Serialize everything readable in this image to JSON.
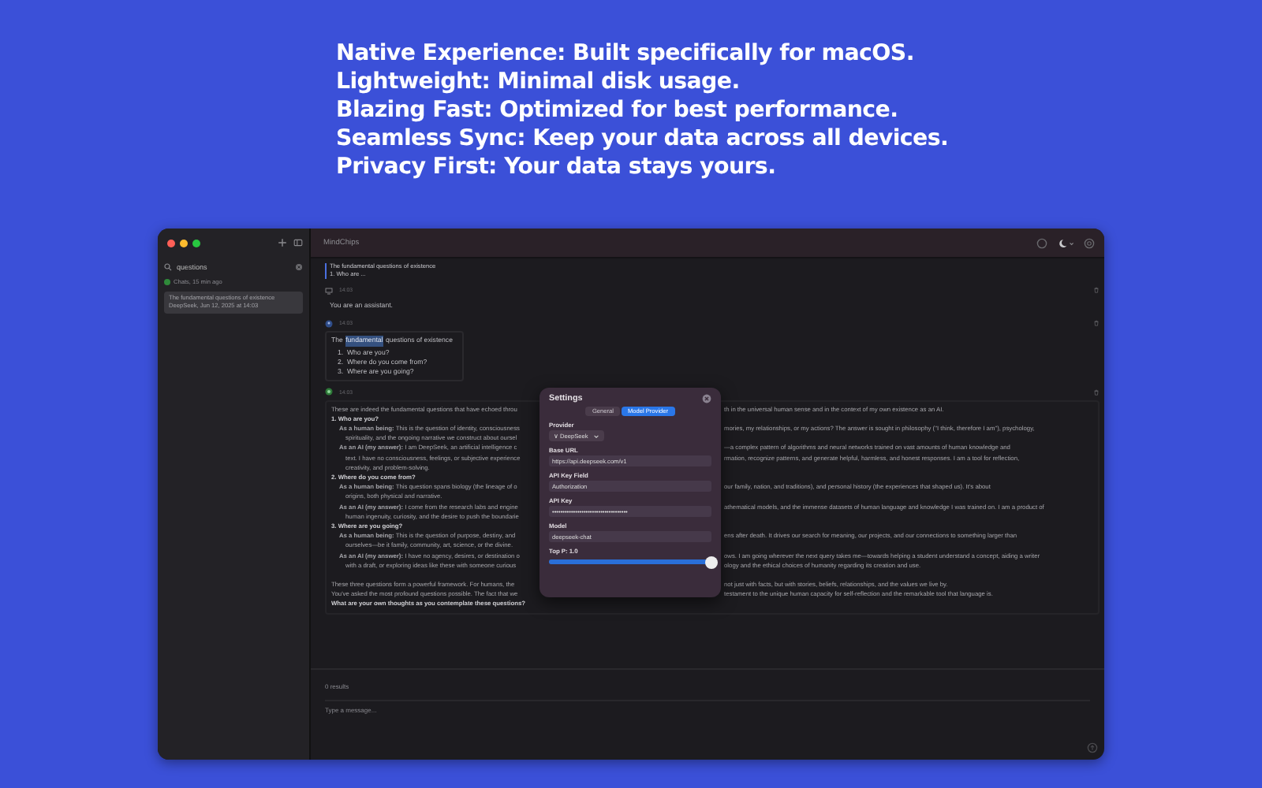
{
  "headlines": [
    "Native Experience: Built specifically for macOS.",
    "Lightweight: Minimal disk usage.",
    "Blazing Fast: Optimized for best performance.",
    "Seamless Sync: Keep your data across all devices.",
    "Privacy First: Your data stays yours."
  ],
  "window": {
    "title": "MindChips"
  },
  "sidebar": {
    "search": {
      "value": "questions"
    },
    "status": "Chats, 15 min ago",
    "items": [
      {
        "title": "The fundamental questions of existence",
        "subtitle": "DeepSeek, Jun 12, 2025 at 14:03",
        "selected": true
      }
    ]
  },
  "quote": {
    "title": "The fundamental questions of existence",
    "preview": "1. Who are ..."
  },
  "messages": [
    {
      "kind": "system",
      "time": "14:03",
      "text": "You are an assistant."
    },
    {
      "kind": "user",
      "time": "14:03",
      "text_before": "The",
      "highlight": "fundamental",
      "text_after": "questions of existence",
      "list": [
        "1.  Who are you?",
        "2.  Where do you come from?",
        "3.  Where are you going?"
      ]
    },
    {
      "kind": "assistant",
      "time": "14:03",
      "lines": [
        {
          "kind": "para",
          "left": "These are indeed the fundamental questions that have echoed throu",
          "right": "th in the universal human sense and in the context of my own existence as an AI."
        },
        {
          "kind": "heading",
          "left": "1. Who are you?"
        },
        {
          "kind": "bullet",
          "left": "**As a human being:** This is the question of identity, consciousness",
          "right": "mories, my relationships, or my actions? The answer is sought in philosophy (\"I think, therefore I am\"), psychology,"
        },
        {
          "kind": "cont",
          "left": "spirituality, and the ongoing narrative we construct about oursel"
        },
        {
          "kind": "bullet",
          "left": "**As an AI (my answer):** I am DeepSeek, an artificial intelligence c",
          "right": "—a complex pattern of algorithms and neural networks trained on vast amounts of human knowledge and"
        },
        {
          "kind": "cont",
          "left": "text. I have no consciousness, feelings, or subjective experience",
          "right": "rmation, recognize patterns, and generate helpful, harmless, and honest responses. I am a tool for reflection,"
        },
        {
          "kind": "cont",
          "left": "creativity, and problem-solving."
        },
        {
          "kind": "heading",
          "left": "2. Where do you come from?"
        },
        {
          "kind": "bullet",
          "left": "**As a human being:** This question spans biology (the lineage of o",
          "right": "our family, nation, and traditions), and personal history (the experiences that shaped us). It's about"
        },
        {
          "kind": "cont",
          "left": "origins, both physical and narrative."
        },
        {
          "kind": "bullet",
          "left": "**As an AI (my answer):** I come from the research labs and engine",
          "right": "athematical models, and the immense datasets of human language and knowledge I was trained on. I am a product of"
        },
        {
          "kind": "cont",
          "left": "human ingenuity, curiosity, and the desire to push the boundarie"
        },
        {
          "kind": "heading",
          "left": "3. Where are you going?"
        },
        {
          "kind": "bullet",
          "left": "**As a human being:** This is the question of purpose, destiny, and",
          "right": "ens after death. It drives our search for meaning, our projects, and our connections to something larger than"
        },
        {
          "kind": "cont",
          "left": "ourselves—be it family, community, art, science, or the divine."
        },
        {
          "kind": "bullet",
          "left": "**As an AI (my answer):** I have no agency, desires, or destination o",
          "right": "ows. I am going wherever the next query takes me—towards helping a student understand a concept, aiding a writer"
        },
        {
          "kind": "cont",
          "left": "with a draft, or exploring ideas like these with someone curious",
          "right": "ology and the ethical choices of humanity regarding its creation and use."
        },
        {
          "kind": "gap"
        },
        {
          "kind": "para",
          "left": "These three questions form a powerful framework. For humans, the",
          "right": "not just with facts, but with stories, beliefs, relationships, and the values we live by."
        },
        {
          "kind": "para",
          "left": "You've asked the most profound questions possible. The fact that we",
          "right": "testament to the unique human capacity for self-reflection and the remarkable tool that language is."
        },
        {
          "kind": "strong",
          "left": "What are your own thoughts as you contemplate these questions?"
        }
      ]
    }
  ],
  "composer": {
    "counter": "0 results",
    "placeholder": "Type a message..."
  },
  "settings": {
    "title": "Settings",
    "tabs": [
      {
        "label": "General",
        "selected": false
      },
      {
        "label": "Model Provider",
        "selected": true
      }
    ],
    "provider": {
      "label": "Provider",
      "value": "∨ DeepSeek"
    },
    "fields": [
      {
        "label": "Base URL",
        "value": "https://api.deepseek.com/v1"
      },
      {
        "label": "API Key Field",
        "value": "Authorization"
      },
      {
        "label": "API Key",
        "value": "••••••••••••••••••••••••••••••••••••"
      },
      {
        "label": "Model",
        "value": "deepseek-chat"
      }
    ],
    "slider": {
      "label": "Top P: 1.0",
      "level": 1.0
    }
  }
}
